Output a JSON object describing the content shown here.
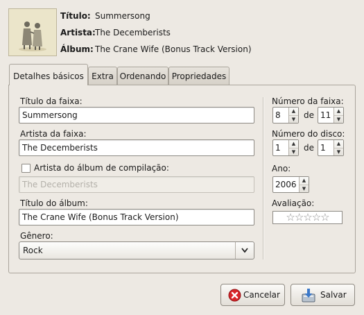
{
  "header": {
    "title_label": "Título:",
    "title_value": "Summersong",
    "artist_label": "Artista:",
    "artist_value": "The Decemberists",
    "album_label": "Álbum:",
    "album_value": "The Crane Wife (Bonus Track Version)"
  },
  "tabs": [
    {
      "label": "Detalhes básicos",
      "active": true
    },
    {
      "label": "Extra",
      "active": false
    },
    {
      "label": "Ordenando",
      "active": false
    },
    {
      "label": "Propriedades",
      "active": false
    }
  ],
  "form": {
    "track_title_label": "Título da faixa:",
    "track_title_value": "Summersong",
    "track_artist_label": "Artista da faixa:",
    "track_artist_value": "The Decemberists",
    "compilation_label": "Artista do álbum de compilação:",
    "compilation_checked": false,
    "album_artist_value": "The Decemberists",
    "album_title_label": "Título do álbum:",
    "album_title_value": "The Crane Wife (Bonus Track Version)",
    "genre_label": "Gênero:",
    "genre_value": "Rock",
    "track_number_label": "Número da faixa:",
    "track_number": "8",
    "of_label": "de",
    "track_total": "11",
    "disc_number_label": "Número do disco:",
    "disc_number": "1",
    "disc_total": "1",
    "year_label": "Ano:",
    "year_value": "2006",
    "rating_label": "Avaliação:",
    "rating_value": 0,
    "rating_max": 5
  },
  "buttons": {
    "cancel_label": "Cancelar",
    "save_label": "Salvar"
  },
  "colors": {
    "window_bg": "#ede9e3",
    "cancel_icon": "#d9262a",
    "save_icon": "#3b78c9"
  }
}
